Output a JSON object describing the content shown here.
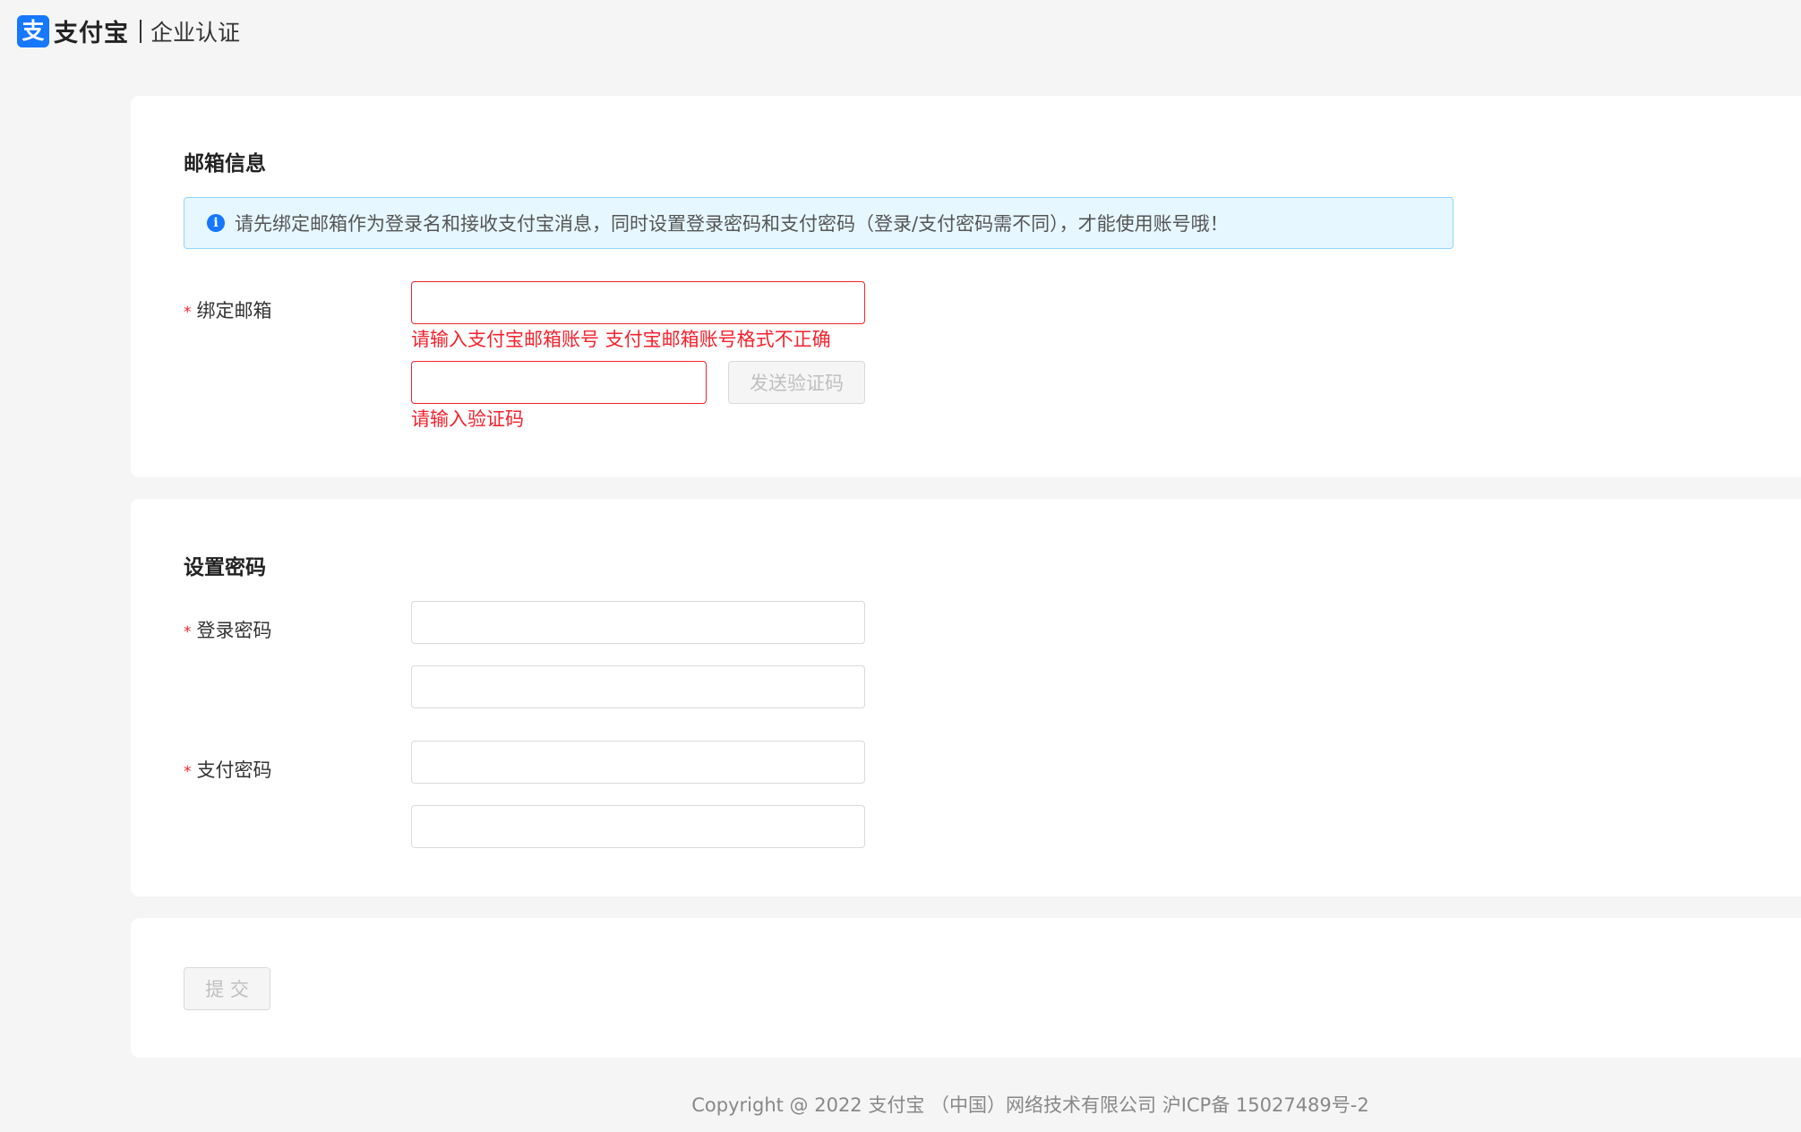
{
  "header": {
    "logo_mark": "支",
    "logo_text": "支付宝",
    "subtitle": "企业认证"
  },
  "email_section": {
    "title": "邮箱信息",
    "notice": "请先绑定邮箱作为登录名和接收支付宝消息，同时设置登录密码和支付密码（登录/支付密码需不同），才能使用账号哦！",
    "bind_email_label": "绑定邮箱",
    "email_input": {
      "value": "",
      "placeholder": ""
    },
    "email_error": "请输入支付宝邮箱账号 支付宝邮箱账号格式不正确",
    "code_input": {
      "value": "",
      "placeholder": ""
    },
    "send_code_button": "发送验证码",
    "code_error": "请输入验证码"
  },
  "password_section": {
    "title": "设置密码",
    "login_password_label": "登录密码",
    "pay_password_label": "支付密码"
  },
  "submit": {
    "button_label": "提 交"
  },
  "footer": {
    "copyright": "Copyright @ 2022 支付宝 （中国）网络技术有限公司 沪ICP备 15027489号-2"
  },
  "colors": {
    "brand": "#1677ff",
    "error": "#f5222d",
    "info_bg": "#e6f7ff",
    "info_border": "#91d5ff"
  }
}
